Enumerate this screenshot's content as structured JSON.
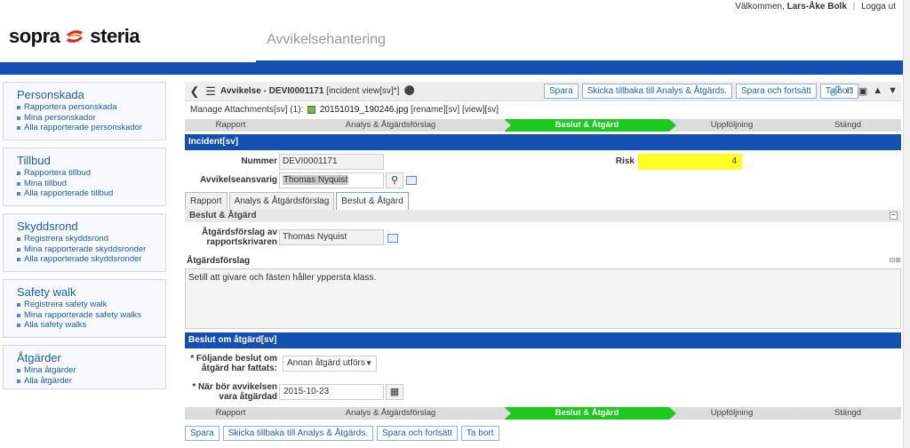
{
  "header": {
    "welcome": "Välkommen,",
    "user": "Lars-Åke Bolk",
    "logout": "Logga ut",
    "logo_left": "sopra",
    "logo_right": "steria",
    "app_title": "Avvikelsehantering"
  },
  "sidebar": [
    {
      "title": "Personskada",
      "items": [
        "Rapportera personskada",
        "Mina personskador",
        "Alla rapporterade personskador"
      ]
    },
    {
      "title": "Tillbud",
      "items": [
        "Rapportera tillbud",
        "Mina tillbud",
        "Alla rapporterade tillbud"
      ]
    },
    {
      "title": "Skyddsrond",
      "items": [
        "Registrera skyddsrond",
        "Mina rapporterade skyddsronder",
        "Alla rapporterade skyddsronder"
      ]
    },
    {
      "title": "Safety walk",
      "items": [
        "Registrera safety walk",
        "Mina rapporterade safety walks",
        "Alla safety walks"
      ]
    },
    {
      "title": "Åtgärder",
      "items": [
        "Mina åtgärder",
        "Alla åtgärder"
      ]
    }
  ],
  "titlebar": {
    "title_bold": "Avvikelse - DEVI0001171",
    "title_rest": " [incident view[sv]*]",
    "buttons": {
      "save": "Spara",
      "send_back": "Skicka tillbaka till Analys & Åtgärds.",
      "save_continue": "Spara och fortsätt",
      "delete": "Ta bort"
    }
  },
  "attachments": {
    "label": "Manage Attachments[sv] (1):",
    "file": "20151019_190246.jpg",
    "actions": "[rename][sv] [view][sv]"
  },
  "steps": [
    {
      "label": "Rapport",
      "active": false
    },
    {
      "label": "Analys & Åtgärdsförslag",
      "active": false
    },
    {
      "label": "Beslut & Åtgärd",
      "active": true
    },
    {
      "label": "Uppföljning",
      "active": false
    },
    {
      "label": "Stängd",
      "active": false
    }
  ],
  "incident": {
    "section_title": "Incident[sv]",
    "number_label": "Nummer",
    "number_value": "DEVI0001171",
    "risk_label": "Risk",
    "risk_value": "4",
    "owner_label": "Avvikelseansvarig",
    "owner_value": "Thomas Nyquist"
  },
  "tabs": [
    "Rapport",
    "Analys & Åtgärdsförslag",
    "Beslut & Åtgärd"
  ],
  "beslut": {
    "subhead": "Beslut & Åtgärd",
    "proposal_by_label_1": "Åtgärdsförslag av",
    "proposal_by_label_2": "rapportskrivaren",
    "proposal_by_value": "Thomas Nyquist",
    "proposal_label": "Åtgärdsförslag",
    "proposal_text": "Setill att givare och fästen håller yppersta klass."
  },
  "decision": {
    "section_title": "Beslut om åtgärd[sv]",
    "decision_label_1": "* Följande beslut om",
    "decision_label_2": "åtgärd har fattats:",
    "decision_value": "Annan åtgärd utförs",
    "date_label_1": "* När bör avvikelsen",
    "date_label_2": "vara åtgärdad",
    "date_value": "2015-10-23"
  },
  "bottom_buttons": {
    "save": "Spara",
    "send_back": "Skicka tillbaka till Analys & Åtgärds.",
    "save_continue": "Spara och fortsätt",
    "delete": "Ta bort"
  },
  "icons": {
    "nav_back": "chevron-left-icon",
    "menu": "hamburger-icon",
    "tag": "tag-icon",
    "toolbar": [
      "link-icon",
      "folder-icon",
      "folder-open-icon",
      "arrow-up-icon",
      "arrow-down-icon"
    ]
  },
  "colors": {
    "brand_blue": "#1450b4",
    "active_step": "#1ec81e",
    "risk_bg": "#ffff22",
    "link": "#1b5eaa"
  }
}
